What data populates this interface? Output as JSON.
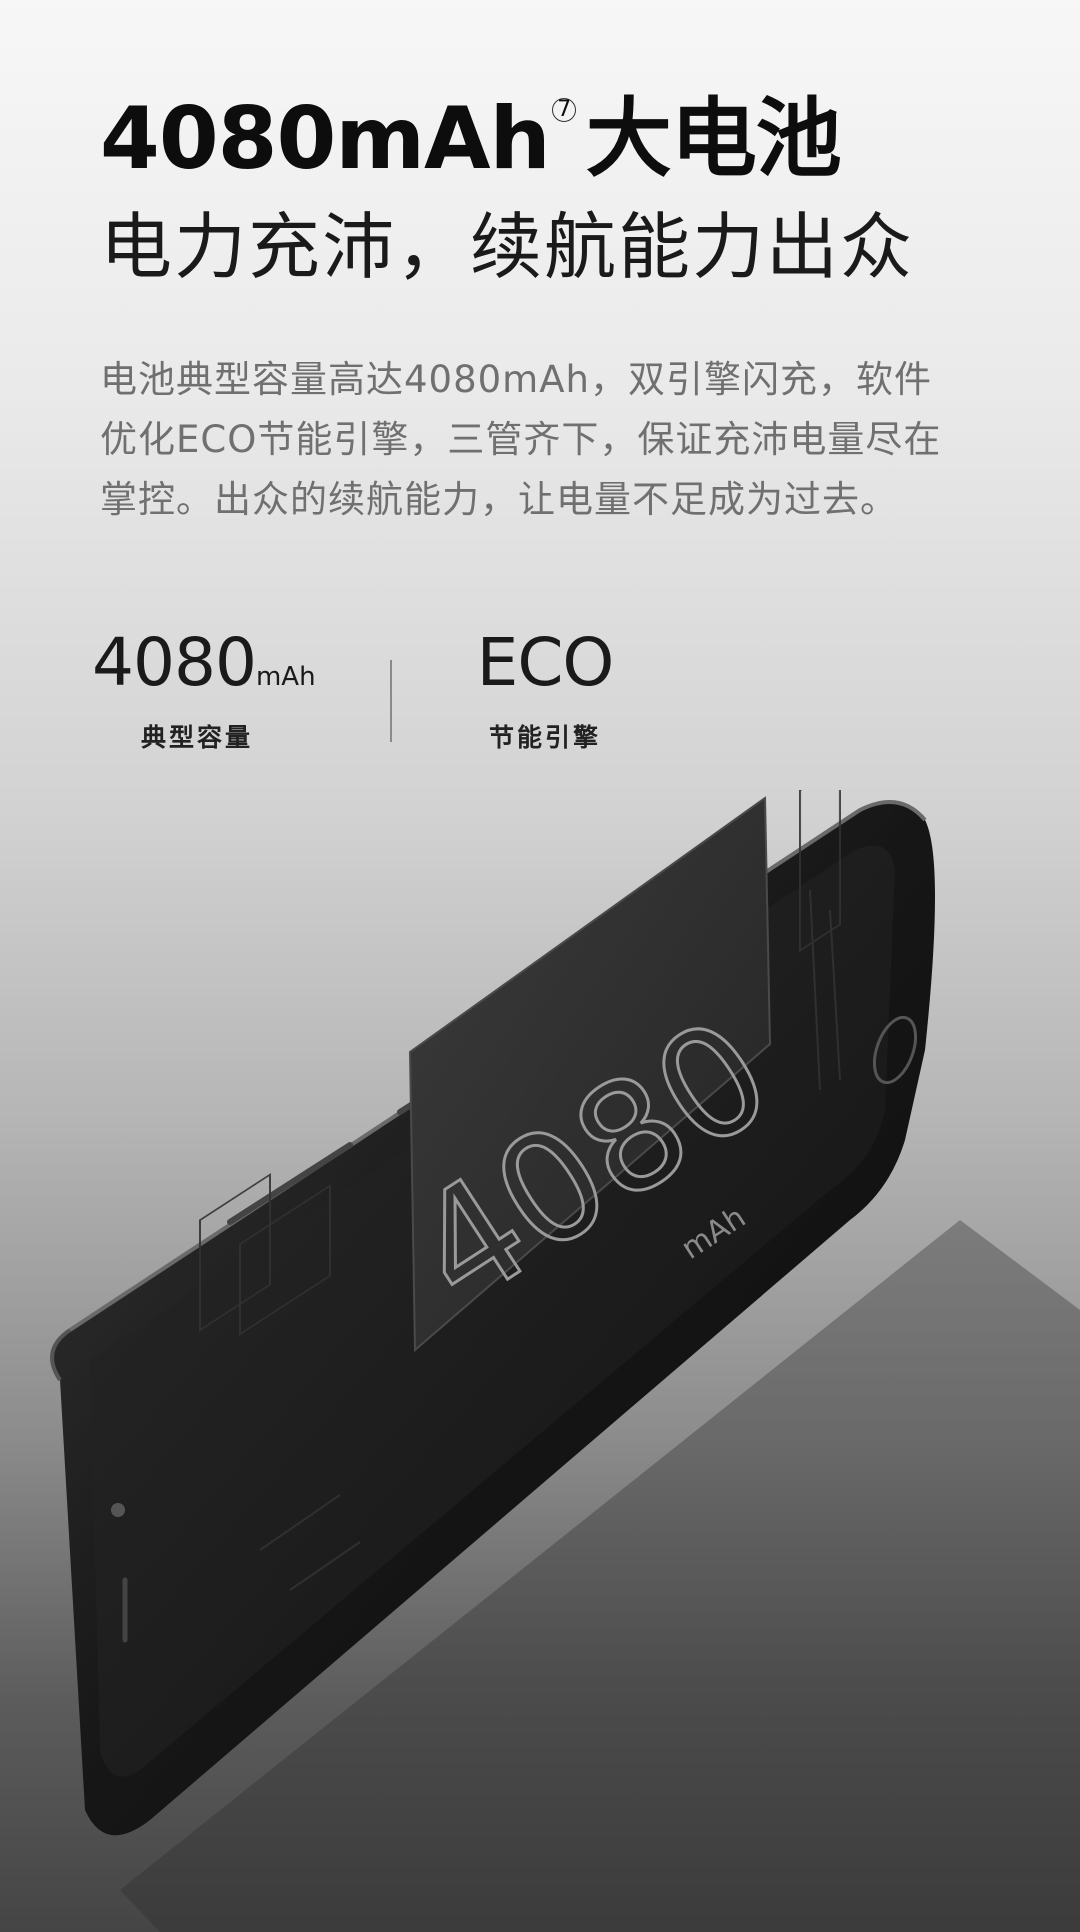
{
  "hero": {
    "title": "4080mAh",
    "title_note": "7",
    "title_suffix": "大电池",
    "subtitle": "电力充沛，续航能力出众",
    "description": "电池典型容量高达4080mAh，双引擎闪充，软件优化ECO节能引擎，三管齐下，保证充沛电量尽在掌控。出众的续航能力，让电量不足成为过去。"
  },
  "stats": [
    {
      "value": "4080",
      "unit": "mAh",
      "label": "典型容量"
    },
    {
      "value": "ECO",
      "unit": "",
      "label": "节能引擎"
    }
  ],
  "phone": {
    "battery_value": "4080",
    "battery_unit": "mAh"
  }
}
